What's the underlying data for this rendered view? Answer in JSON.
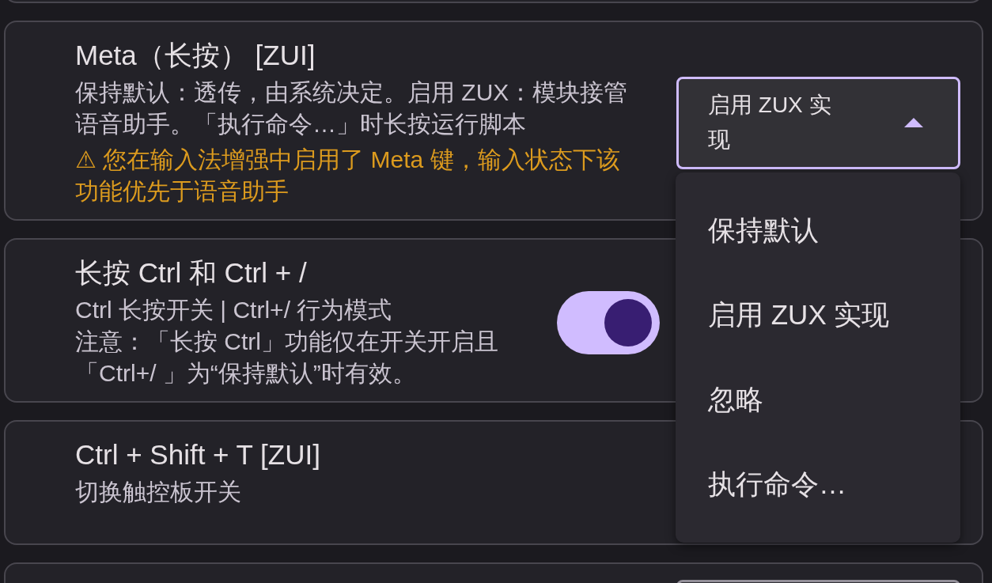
{
  "settings": [
    {
      "kind": "select",
      "title": "Meta（长按） [ZUI]",
      "description": [
        "保持默认：透传，由系统决定。启用 ZUX：模块接管语音助手。「执行命令…」时长按运行脚本"
      ],
      "warning": "⚠ 您在输入法增强中启用了 Meta 键，输入状态下该功能优先于语音助手",
      "select": {
        "value": "启用 ZUX 实现",
        "expanded": true,
        "options": [
          "保持默认",
          "启用 ZUX 实现",
          "忽略",
          "执行命令…"
        ]
      }
    },
    {
      "kind": "switch",
      "title": "长按 Ctrl 和 Ctrl + /",
      "description": [
        "Ctrl 长按开关 | Ctrl+/ 行为模式",
        "注意：「长按 Ctrl」功能仅在开关开启且「Ctrl+/ 」为“保持默认”时有效。"
      ],
      "switch": {
        "on": true
      }
    },
    {
      "kind": "plain",
      "title": "Ctrl + Shift + T [ZUI]",
      "description": [
        "切换触控板开关"
      ]
    },
    {
      "kind": "select",
      "select": {
        "expanded": false
      }
    }
  ]
}
